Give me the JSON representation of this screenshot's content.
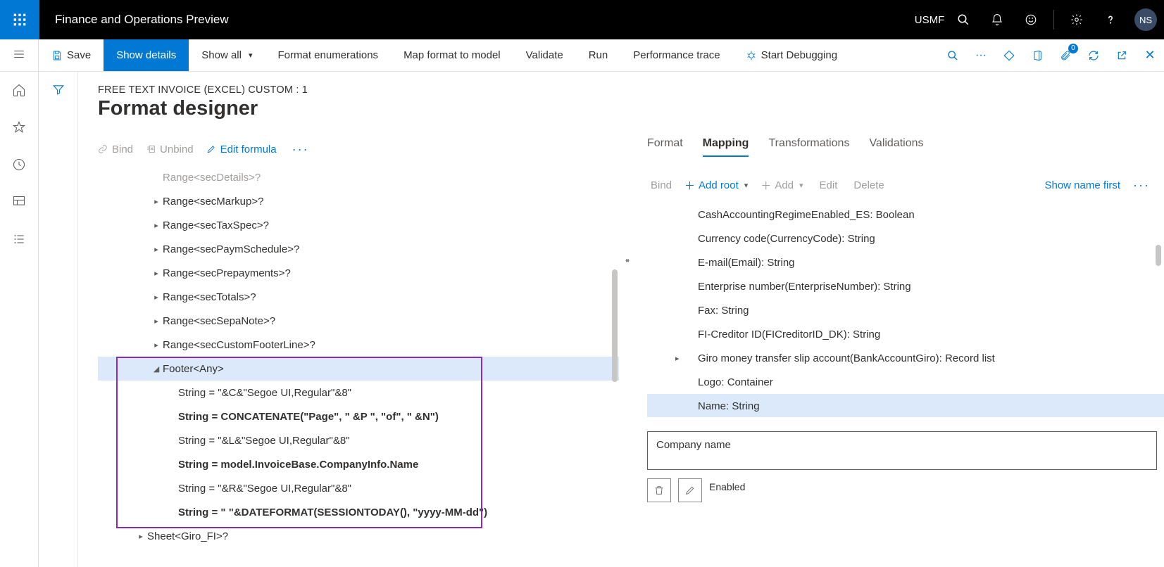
{
  "topbar": {
    "app_title": "Finance and Operations Preview",
    "company": "USMF",
    "avatar": "NS"
  },
  "actionbar": {
    "save": "Save",
    "show_details": "Show details",
    "show_all": "Show all",
    "format_enum": "Format enumerations",
    "map_format": "Map format to model",
    "validate": "Validate",
    "run": "Run",
    "perf_trace": "Performance trace",
    "start_debug": "Start Debugging",
    "attach_badge": "0"
  },
  "breadcrumb": "FREE TEXT INVOICE (EXCEL) CUSTOM : 1",
  "page_title": "Format designer",
  "left_toolbar": {
    "bind": "Bind",
    "unbind": "Unbind",
    "edit_formula": "Edit formula"
  },
  "tree_rows": [
    {
      "indent": 2,
      "tw": "",
      "text": "Range<secDetails>?",
      "grey": true
    },
    {
      "indent": 2,
      "tw": "▸",
      "text": "Range<secMarkup>?"
    },
    {
      "indent": 2,
      "tw": "▸",
      "text": "Range<secTaxSpec>?"
    },
    {
      "indent": 2,
      "tw": "▸",
      "text": "Range<secPaymSchedule>?"
    },
    {
      "indent": 2,
      "tw": "▸",
      "text": "Range<secPrepayments>?"
    },
    {
      "indent": 2,
      "tw": "▸",
      "text": "Range<secTotals>?"
    },
    {
      "indent": 2,
      "tw": "▸",
      "text": "Range<secSepaNote>?"
    },
    {
      "indent": 2,
      "tw": "▸",
      "text": "Range<secCustomFooterLine>?"
    },
    {
      "indent": 2,
      "tw": "◢",
      "text": "Footer<Any>",
      "selected": true
    },
    {
      "indent": 3,
      "tw": "",
      "text": "String = \"&C&\"Segoe UI,Regular\"&8\""
    },
    {
      "indent": 3,
      "tw": "",
      "text": "String = CONCATENATE(\"Page\", \" &P \", \"of\", \" &N\")",
      "bold": true
    },
    {
      "indent": 3,
      "tw": "",
      "text": "String = \"&L&\"Segoe UI,Regular\"&8\""
    },
    {
      "indent": 3,
      "tw": "",
      "text": "String = model.InvoiceBase.CompanyInfo.Name",
      "bold": true
    },
    {
      "indent": 3,
      "tw": "",
      "text": "String = \"&R&\"Segoe UI,Regular\"&8\""
    },
    {
      "indent": 3,
      "tw": "",
      "text": "String = \" \"&DATEFORMAT(SESSIONTODAY(), \"yyyy-MM-dd\")",
      "bold": true
    },
    {
      "indent": 1,
      "tw": "▸",
      "text": "Sheet<Giro_FI>?"
    }
  ],
  "tabs": {
    "format": "Format",
    "mapping": "Mapping",
    "transformations": "Transformations",
    "validations": "Validations"
  },
  "right_toolbar": {
    "bind": "Bind",
    "add_root": "Add root",
    "add": "Add",
    "edit": "Edit",
    "delete": "Delete",
    "show_name_first": "Show name first"
  },
  "right_tree": [
    {
      "text": "CashAccountingRegimeEnabled_ES: Boolean"
    },
    {
      "text": "Currency code(CurrencyCode): String"
    },
    {
      "text": "E-mail(Email): String"
    },
    {
      "text": "Enterprise number(EnterpriseNumber): String"
    },
    {
      "text": "Fax: String"
    },
    {
      "text": "FI-Creditor ID(FICreditorID_DK): String"
    },
    {
      "text": "Giro money transfer slip account(BankAccountGiro): Record list",
      "tw": "▸"
    },
    {
      "text": "Logo: Container"
    },
    {
      "text": "Name: String",
      "selected": true
    }
  ],
  "fieldbox": {
    "company_name": "Company name",
    "enabled": "Enabled"
  }
}
